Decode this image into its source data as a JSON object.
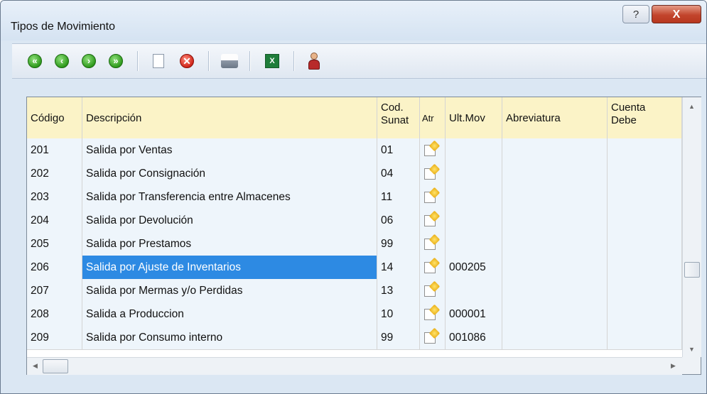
{
  "window": {
    "title": "Tipos de Movimiento",
    "help_glyph": "?",
    "close_glyph": "X"
  },
  "toolbar": {
    "buttons": [
      {
        "name": "first-record-button",
        "icon": "arrow-first-icon"
      },
      {
        "name": "previous-record-button",
        "icon": "arrow-left-icon"
      },
      {
        "name": "next-record-button",
        "icon": "arrow-right-icon"
      },
      {
        "name": "last-record-button",
        "icon": "arrow-last-icon"
      },
      {
        "name": "new-document-button",
        "icon": "new-document-icon"
      },
      {
        "name": "delete-button",
        "icon": "delete-icon"
      },
      {
        "name": "print-button",
        "icon": "printer-icon"
      },
      {
        "name": "export-excel-button",
        "icon": "excel-icon"
      },
      {
        "name": "user-button",
        "icon": "user-icon"
      }
    ],
    "excel_glyph": "X",
    "delete_glyph": "✕"
  },
  "grid": {
    "columns": [
      {
        "key": "codigo",
        "label": "Código"
      },
      {
        "key": "descripcion",
        "label": "Descripción"
      },
      {
        "key": "cod_sunat",
        "label": "Cod.\nSunat"
      },
      {
        "key": "atr",
        "label": "Atr"
      },
      {
        "key": "ult_mov",
        "label": "Ult.Mov"
      },
      {
        "key": "abreviatura",
        "label": "Abreviatura"
      },
      {
        "key": "cuenta_debe",
        "label": "Cuenta\nDebe"
      }
    ],
    "rows": [
      {
        "codigo": "201",
        "descripcion": "Salida por Ventas",
        "cod_sunat": "01",
        "ult_mov": "",
        "abreviatura": "",
        "cuenta_debe": ""
      },
      {
        "codigo": "202",
        "descripcion": "Salida por Consignación",
        "cod_sunat": "04",
        "ult_mov": "",
        "abreviatura": "",
        "cuenta_debe": ""
      },
      {
        "codigo": "203",
        "descripcion": "Salida por Transferencia entre Almacenes",
        "cod_sunat": "11",
        "ult_mov": "",
        "abreviatura": "",
        "cuenta_debe": ""
      },
      {
        "codigo": "204",
        "descripcion": "Salida por Devolución",
        "cod_sunat": "06",
        "ult_mov": "",
        "abreviatura": "",
        "cuenta_debe": ""
      },
      {
        "codigo": "205",
        "descripcion": "Salida por Prestamos",
        "cod_sunat": "99",
        "ult_mov": "",
        "abreviatura": "",
        "cuenta_debe": ""
      },
      {
        "codigo": "206",
        "descripcion": "Salida por Ajuste de Inventarios",
        "cod_sunat": "14",
        "ult_mov": "000205",
        "abreviatura": "",
        "cuenta_debe": "",
        "selected": true
      },
      {
        "codigo": "207",
        "descripcion": "Salida por Mermas y/o Perdidas",
        "cod_sunat": "13",
        "ult_mov": "",
        "abreviatura": "",
        "cuenta_debe": ""
      },
      {
        "codigo": "208",
        "descripcion": "Salida a Produccion",
        "cod_sunat": "10",
        "ult_mov": "000001",
        "abreviatura": "",
        "cuenta_debe": ""
      },
      {
        "codigo": "209",
        "descripcion": "Salida por Consumo interno",
        "cod_sunat": "99",
        "ult_mov": "001086",
        "abreviatura": "",
        "cuenta_debe": ""
      }
    ]
  },
  "colors": {
    "selection": "#2d8ae3",
    "header_bg": "#fbf3c7",
    "row_bg": "#eef5fb"
  }
}
